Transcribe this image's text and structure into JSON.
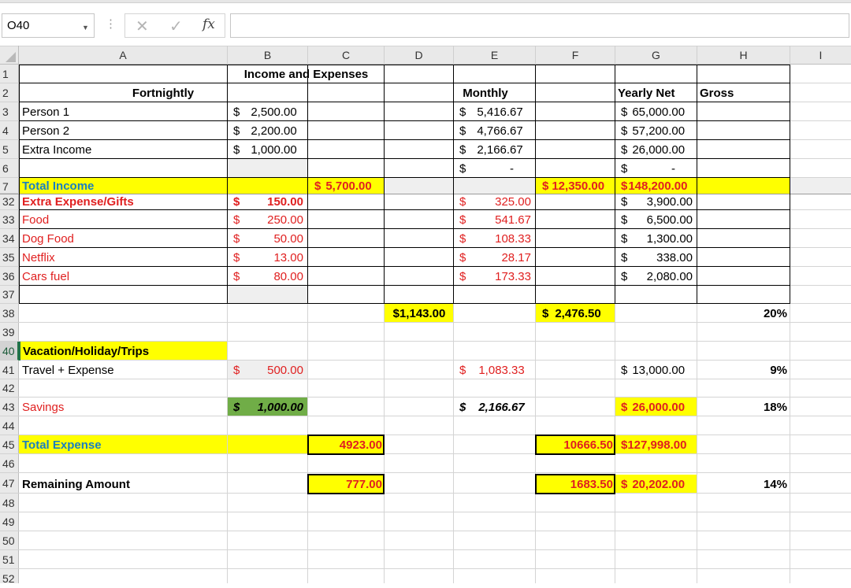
{
  "formula_bar": {
    "name_box": "O40",
    "cancel_icon": "✕",
    "enter_icon": "✓",
    "fx_label": "fx",
    "formula": ""
  },
  "columns": [
    "A",
    "B",
    "C",
    "D",
    "E",
    "F",
    "G",
    "H",
    "I"
  ],
  "rows": [
    "1",
    "2",
    "3",
    "4",
    "5",
    "6",
    "7",
    "32",
    "33",
    "34",
    "35",
    "36",
    "37",
    "38",
    "39",
    "40",
    "41",
    "42",
    "43",
    "44",
    "45",
    "46",
    "47",
    "48",
    "49",
    "50",
    "51",
    "52"
  ],
  "sheet": {
    "title": "Income and Expenses",
    "hdr_fortnightly": "Fortnightly",
    "hdr_monthly": "Monthly",
    "hdr_yearly_net": "Yearly Net",
    "hdr_gross": "Gross",
    "currency": "$",
    "dash": "-",
    "person1": {
      "label": "Person 1",
      "b": "2,500.00",
      "e": "5,416.67",
      "g": "65,000.00"
    },
    "person2": {
      "label": "Person 2",
      "b": "2,200.00",
      "e": "4,766.67",
      "g": "57,200.00"
    },
    "extra_income": {
      "label": "Extra Income",
      "b": "1,000.00",
      "e": "2,166.67",
      "g": "26,000.00"
    },
    "total_income": {
      "label": "Total Income",
      "c": "5,700.00",
      "f": "12,350.00",
      "g": "148,200.00"
    },
    "expense_gifts": {
      "label": "Extra Expense/Gifts",
      "b": "150.00",
      "e": "325.00",
      "g": "3,900.00"
    },
    "food": {
      "label": "Food",
      "b": "250.00",
      "e": "541.67",
      "g": "6,500.00"
    },
    "dog_food": {
      "label": "Dog Food",
      "b": "50.00",
      "e": "108.33",
      "g": "1,300.00"
    },
    "netflix": {
      "label": "Netflix",
      "b": "13.00",
      "e": "28.17",
      "g": "338.00"
    },
    "cars_fuel": {
      "label": "Cars fuel",
      "b": "80.00",
      "e": "173.33",
      "g": "2,080.00"
    },
    "row38": {
      "d": "$1,143.00",
      "f": "2,476.50",
      "h": "20%"
    },
    "vacation_header": "Vacation/Holiday/Trips",
    "travel": {
      "label": "Travel + Expense",
      "b": "500.00",
      "e": "1,083.33",
      "g": "13,000.00",
      "h": "9%"
    },
    "savings": {
      "label": "Savings",
      "b": "1,000.00",
      "e": "2,166.67",
      "g": "26,000.00",
      "h": "18%"
    },
    "total_expense": {
      "label": "Total Expense",
      "c": "4923.00",
      "f": "10666.50",
      "g": "$127,998.00"
    },
    "remaining": {
      "label": "Remaining Amount",
      "c": "777.00",
      "f": "1683.50",
      "g": "20,202.00",
      "h": "14%"
    }
  },
  "colors": {
    "yellow_fill": "#ffff00",
    "green_fill": "#70ad47",
    "gray_fill": "#efefef",
    "red_text": "#e02020",
    "blue_text": "#1a7fc1"
  }
}
